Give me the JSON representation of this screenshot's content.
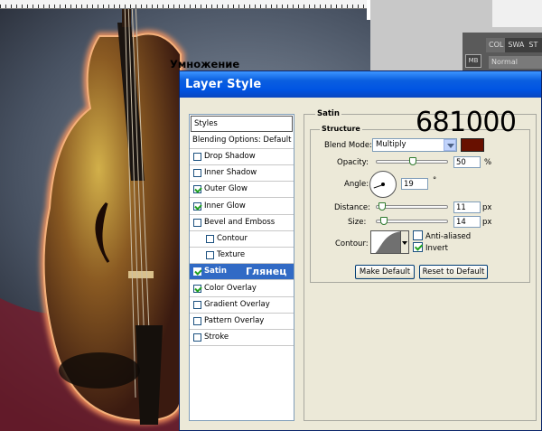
{
  "dialog": {
    "title": "Layer Style"
  },
  "swatch_panel": {
    "tabs": [
      "COL",
      "SWA",
      "ST"
    ],
    "icon_label": "MB",
    "mode": "Normal"
  },
  "styles": {
    "header": "Styles",
    "blending_options": "Blending Options: Default",
    "items": [
      {
        "label": "Drop Shadow",
        "checked": false
      },
      {
        "label": "Inner Shadow",
        "checked": false
      },
      {
        "label": "Outer Glow",
        "checked": true
      },
      {
        "label": "Inner Glow",
        "checked": true
      },
      {
        "label": "Bevel and Emboss",
        "checked": false
      },
      {
        "label": "Contour",
        "checked": false
      },
      {
        "label": "Texture",
        "checked": false
      },
      {
        "label": "Satin",
        "checked": true,
        "selected": true
      },
      {
        "label": "Color Overlay",
        "checked": true
      },
      {
        "label": "Gradient Overlay",
        "checked": false
      },
      {
        "label": "Pattern Overlay",
        "checked": false
      },
      {
        "label": "Stroke",
        "checked": false
      }
    ],
    "satin_annotation": "Глянец"
  },
  "satin": {
    "section_title": "Satin",
    "structure_title": "Structure",
    "blend_mode_label": "Blend Mode:",
    "blend_mode": "Multiply",
    "blend_annotation": "Умножение",
    "color": "#681000",
    "color_annotation": "681000",
    "opacity_label": "Opacity:",
    "opacity": "50",
    "opacity_unit": "%",
    "angle_label": "Angle:",
    "angle": "19",
    "angle_unit": "°",
    "distance_label": "Distance:",
    "distance": "11",
    "distance_unit": "px",
    "size_label": "Size:",
    "size": "14",
    "size_unit": "px",
    "contour_label": "Contour:",
    "anti_aliased_label": "Anti-aliased",
    "anti_aliased": false,
    "invert_label": "Invert",
    "invert": true
  },
  "buttons": {
    "make_default": "Make Default",
    "reset_default": "Reset to Default"
  }
}
